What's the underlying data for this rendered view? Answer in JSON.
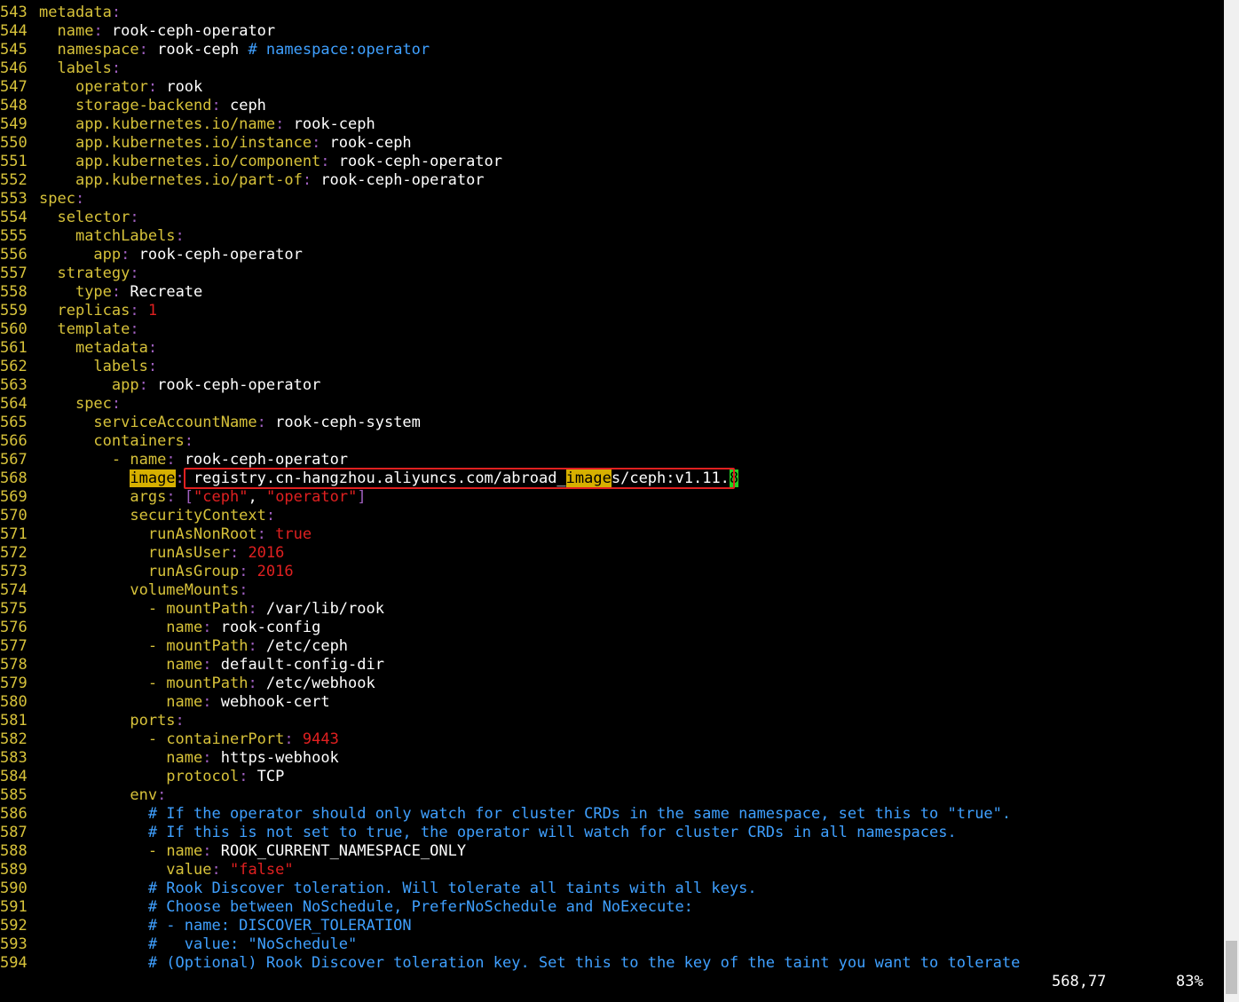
{
  "status": {
    "position": "568,77",
    "percent": "83%"
  },
  "lines": [
    {
      "n": "543",
      "segs": [
        {
          "t": "metadata",
          "c": "key"
        },
        {
          "t": ":",
          "c": "punc"
        }
      ]
    },
    {
      "n": "544",
      "segs": [
        {
          "t": "  "
        },
        {
          "t": "name",
          "c": "key"
        },
        {
          "t": ":",
          "c": "punc"
        },
        {
          "t": " rook-ceph-operator",
          "c": "val"
        }
      ]
    },
    {
      "n": "545",
      "segs": [
        {
          "t": "  "
        },
        {
          "t": "namespace",
          "c": "key"
        },
        {
          "t": ":",
          "c": "punc"
        },
        {
          "t": " rook-ceph ",
          "c": "val"
        },
        {
          "t": "# namespace:operator",
          "c": "cmt"
        }
      ]
    },
    {
      "n": "546",
      "segs": [
        {
          "t": "  "
        },
        {
          "t": "labels",
          "c": "key"
        },
        {
          "t": ":",
          "c": "punc"
        }
      ]
    },
    {
      "n": "547",
      "segs": [
        {
          "t": "    "
        },
        {
          "t": "operator",
          "c": "key"
        },
        {
          "t": ":",
          "c": "punc"
        },
        {
          "t": " rook",
          "c": "val"
        }
      ]
    },
    {
      "n": "548",
      "segs": [
        {
          "t": "    "
        },
        {
          "t": "storage-backend",
          "c": "key"
        },
        {
          "t": ":",
          "c": "punc"
        },
        {
          "t": " ceph",
          "c": "val"
        }
      ]
    },
    {
      "n": "549",
      "segs": [
        {
          "t": "    "
        },
        {
          "t": "app.kubernetes.io/name",
          "c": "key"
        },
        {
          "t": ":",
          "c": "punc"
        },
        {
          "t": " rook-ceph",
          "c": "val"
        }
      ]
    },
    {
      "n": "550",
      "segs": [
        {
          "t": "    "
        },
        {
          "t": "app.kubernetes.io/instance",
          "c": "key"
        },
        {
          "t": ":",
          "c": "punc"
        },
        {
          "t": " rook-ceph",
          "c": "val"
        }
      ]
    },
    {
      "n": "551",
      "segs": [
        {
          "t": "    "
        },
        {
          "t": "app.kubernetes.io/component",
          "c": "key"
        },
        {
          "t": ":",
          "c": "punc"
        },
        {
          "t": " rook-ceph-operator",
          "c": "val"
        }
      ]
    },
    {
      "n": "552",
      "segs": [
        {
          "t": "    "
        },
        {
          "t": "app.kubernetes.io/part-of",
          "c": "key"
        },
        {
          "t": ":",
          "c": "punc"
        },
        {
          "t": " rook-ceph-operator",
          "c": "val"
        }
      ]
    },
    {
      "n": "553",
      "segs": [
        {
          "t": "spec",
          "c": "key"
        },
        {
          "t": ":",
          "c": "punc"
        }
      ]
    },
    {
      "n": "554",
      "segs": [
        {
          "t": "  "
        },
        {
          "t": "selector",
          "c": "key"
        },
        {
          "t": ":",
          "c": "punc"
        }
      ]
    },
    {
      "n": "555",
      "segs": [
        {
          "t": "    "
        },
        {
          "t": "matchLabels",
          "c": "key"
        },
        {
          "t": ":",
          "c": "punc"
        }
      ]
    },
    {
      "n": "556",
      "segs": [
        {
          "t": "      "
        },
        {
          "t": "app",
          "c": "key"
        },
        {
          "t": ":",
          "c": "punc"
        },
        {
          "t": " rook-ceph-operator",
          "c": "val"
        }
      ]
    },
    {
      "n": "557",
      "segs": [
        {
          "t": "  "
        },
        {
          "t": "strategy",
          "c": "key"
        },
        {
          "t": ":",
          "c": "punc"
        }
      ]
    },
    {
      "n": "558",
      "segs": [
        {
          "t": "    "
        },
        {
          "t": "type",
          "c": "key"
        },
        {
          "t": ":",
          "c": "punc"
        },
        {
          "t": " Recreate",
          "c": "val"
        }
      ]
    },
    {
      "n": "559",
      "segs": [
        {
          "t": "  "
        },
        {
          "t": "replicas",
          "c": "key"
        },
        {
          "t": ":",
          "c": "punc"
        },
        {
          "t": " 1",
          "c": "num"
        }
      ]
    },
    {
      "n": "560",
      "segs": [
        {
          "t": "  "
        },
        {
          "t": "template",
          "c": "key"
        },
        {
          "t": ":",
          "c": "punc"
        }
      ]
    },
    {
      "n": "561",
      "segs": [
        {
          "t": "    "
        },
        {
          "t": "metadata",
          "c": "key"
        },
        {
          "t": ":",
          "c": "punc"
        }
      ]
    },
    {
      "n": "562",
      "segs": [
        {
          "t": "      "
        },
        {
          "t": "labels",
          "c": "key"
        },
        {
          "t": ":",
          "c": "punc"
        }
      ]
    },
    {
      "n": "563",
      "segs": [
        {
          "t": "        "
        },
        {
          "t": "app",
          "c": "key"
        },
        {
          "t": ":",
          "c": "punc"
        },
        {
          "t": " rook-ceph-operator",
          "c": "val"
        }
      ]
    },
    {
      "n": "564",
      "segs": [
        {
          "t": "    "
        },
        {
          "t": "spec",
          "c": "key"
        },
        {
          "t": ":",
          "c": "punc"
        }
      ]
    },
    {
      "n": "565",
      "segs": [
        {
          "t": "      "
        },
        {
          "t": "serviceAccountName",
          "c": "key"
        },
        {
          "t": ":",
          "c": "punc"
        },
        {
          "t": " rook-ceph-system",
          "c": "val"
        }
      ]
    },
    {
      "n": "566",
      "segs": [
        {
          "t": "      "
        },
        {
          "t": "containers",
          "c": "key"
        },
        {
          "t": ":",
          "c": "punc"
        }
      ]
    },
    {
      "n": "567",
      "segs": [
        {
          "t": "        "
        },
        {
          "t": "- ",
          "c": "dash"
        },
        {
          "t": "name",
          "c": "key"
        },
        {
          "t": ":",
          "c": "punc"
        },
        {
          "t": " rook-ceph-operator",
          "c": "val"
        }
      ]
    },
    {
      "n": "568",
      "segs": [
        {
          "t": "          "
        },
        {
          "t": "image",
          "c": "hl"
        },
        {
          "t": ":",
          "c": "punc"
        },
        {
          "t": " registry.cn-hangzhou.aliyuncs.com/abroad_",
          "c": "val"
        },
        {
          "t": "image",
          "c": "hl"
        },
        {
          "t": "s/ceph:v1.11.",
          "c": "val"
        },
        {
          "t": "8",
          "c": "cursor"
        }
      ]
    },
    {
      "n": "569",
      "segs": [
        {
          "t": "          "
        },
        {
          "t": "args",
          "c": "key"
        },
        {
          "t": ":",
          "c": "punc"
        },
        {
          "t": " [",
          "c": "punc"
        },
        {
          "t": "\"ceph\"",
          "c": "str"
        },
        {
          "t": ", ",
          "c": "val"
        },
        {
          "t": "\"operator\"",
          "c": "str"
        },
        {
          "t": "]",
          "c": "punc"
        }
      ]
    },
    {
      "n": "570",
      "segs": [
        {
          "t": "          "
        },
        {
          "t": "securityContext",
          "c": "key"
        },
        {
          "t": ":",
          "c": "punc"
        }
      ]
    },
    {
      "n": "571",
      "segs": [
        {
          "t": "            "
        },
        {
          "t": "runAsNonRoot",
          "c": "key"
        },
        {
          "t": ":",
          "c": "punc"
        },
        {
          "t": " true",
          "c": "bool"
        }
      ]
    },
    {
      "n": "572",
      "segs": [
        {
          "t": "            "
        },
        {
          "t": "runAsUser",
          "c": "key"
        },
        {
          "t": ":",
          "c": "punc"
        },
        {
          "t": " 2016",
          "c": "num"
        }
      ]
    },
    {
      "n": "573",
      "segs": [
        {
          "t": "            "
        },
        {
          "t": "runAsGroup",
          "c": "key"
        },
        {
          "t": ":",
          "c": "punc"
        },
        {
          "t": " 2016",
          "c": "num"
        }
      ]
    },
    {
      "n": "574",
      "segs": [
        {
          "t": "          "
        },
        {
          "t": "volumeMounts",
          "c": "key"
        },
        {
          "t": ":",
          "c": "punc"
        }
      ]
    },
    {
      "n": "575",
      "segs": [
        {
          "t": "            "
        },
        {
          "t": "- ",
          "c": "dash"
        },
        {
          "t": "mountPath",
          "c": "key"
        },
        {
          "t": ":",
          "c": "punc"
        },
        {
          "t": " /var/lib/rook",
          "c": "val"
        }
      ]
    },
    {
      "n": "576",
      "segs": [
        {
          "t": "              "
        },
        {
          "t": "name",
          "c": "key"
        },
        {
          "t": ":",
          "c": "punc"
        },
        {
          "t": " rook-config",
          "c": "val"
        }
      ]
    },
    {
      "n": "577",
      "segs": [
        {
          "t": "            "
        },
        {
          "t": "- ",
          "c": "dash"
        },
        {
          "t": "mountPath",
          "c": "key"
        },
        {
          "t": ":",
          "c": "punc"
        },
        {
          "t": " /etc/ceph",
          "c": "val"
        }
      ]
    },
    {
      "n": "578",
      "segs": [
        {
          "t": "              "
        },
        {
          "t": "name",
          "c": "key"
        },
        {
          "t": ":",
          "c": "punc"
        },
        {
          "t": " default-config-dir",
          "c": "val"
        }
      ]
    },
    {
      "n": "579",
      "segs": [
        {
          "t": "            "
        },
        {
          "t": "- ",
          "c": "dash"
        },
        {
          "t": "mountPath",
          "c": "key"
        },
        {
          "t": ":",
          "c": "punc"
        },
        {
          "t": " /etc/webhook",
          "c": "val"
        }
      ]
    },
    {
      "n": "580",
      "segs": [
        {
          "t": "              "
        },
        {
          "t": "name",
          "c": "key"
        },
        {
          "t": ":",
          "c": "punc"
        },
        {
          "t": " webhook-cert",
          "c": "val"
        }
      ]
    },
    {
      "n": "581",
      "segs": [
        {
          "t": "          "
        },
        {
          "t": "ports",
          "c": "key"
        },
        {
          "t": ":",
          "c": "punc"
        }
      ]
    },
    {
      "n": "582",
      "segs": [
        {
          "t": "            "
        },
        {
          "t": "- ",
          "c": "dash"
        },
        {
          "t": "containerPort",
          "c": "key"
        },
        {
          "t": ":",
          "c": "punc"
        },
        {
          "t": " 9443",
          "c": "num"
        }
      ]
    },
    {
      "n": "583",
      "segs": [
        {
          "t": "              "
        },
        {
          "t": "name",
          "c": "key"
        },
        {
          "t": ":",
          "c": "punc"
        },
        {
          "t": " https-webhook",
          "c": "val"
        }
      ]
    },
    {
      "n": "584",
      "segs": [
        {
          "t": "              "
        },
        {
          "t": "protocol",
          "c": "key"
        },
        {
          "t": ":",
          "c": "punc"
        },
        {
          "t": " TCP",
          "c": "val"
        }
      ]
    },
    {
      "n": "585",
      "segs": [
        {
          "t": "          "
        },
        {
          "t": "env",
          "c": "key"
        },
        {
          "t": ":",
          "c": "punc"
        }
      ]
    },
    {
      "n": "586",
      "segs": [
        {
          "t": "            "
        },
        {
          "t": "# If the operator should only watch for cluster CRDs in the same namespace, set this to \"true\".",
          "c": "cmt"
        }
      ]
    },
    {
      "n": "587",
      "segs": [
        {
          "t": "            "
        },
        {
          "t": "# If this is not set to true, the operator will watch for cluster CRDs in all namespaces.",
          "c": "cmt"
        }
      ]
    },
    {
      "n": "588",
      "segs": [
        {
          "t": "            "
        },
        {
          "t": "- ",
          "c": "dash"
        },
        {
          "t": "name",
          "c": "key"
        },
        {
          "t": ":",
          "c": "punc"
        },
        {
          "t": " ROOK_CURRENT_NAMESPACE_ONLY",
          "c": "val"
        }
      ]
    },
    {
      "n": "589",
      "segs": [
        {
          "t": "              "
        },
        {
          "t": "value",
          "c": "key"
        },
        {
          "t": ":",
          "c": "punc"
        },
        {
          "t": " \"false\"",
          "c": "str"
        }
      ]
    },
    {
      "n": "590",
      "segs": [
        {
          "t": "            "
        },
        {
          "t": "# Rook Discover toleration. Will tolerate all taints with all keys.",
          "c": "cmt"
        }
      ]
    },
    {
      "n": "591",
      "segs": [
        {
          "t": "            "
        },
        {
          "t": "# Choose between NoSchedule, PreferNoSchedule and NoExecute:",
          "c": "cmt"
        }
      ]
    },
    {
      "n": "592",
      "segs": [
        {
          "t": "            "
        },
        {
          "t": "# - name: DISCOVER_TOLERATION",
          "c": "cmt"
        }
      ]
    },
    {
      "n": "593",
      "segs": [
        {
          "t": "            "
        },
        {
          "t": "#   value: \"NoSchedule\"",
          "c": "cmt"
        }
      ]
    },
    {
      "n": "594",
      "segs": [
        {
          "t": "            "
        },
        {
          "t": "# (Optional) Rook Discover toleration key. Set this to the key of the taint you want to tolerate",
          "c": "cmt"
        }
      ]
    }
  ]
}
